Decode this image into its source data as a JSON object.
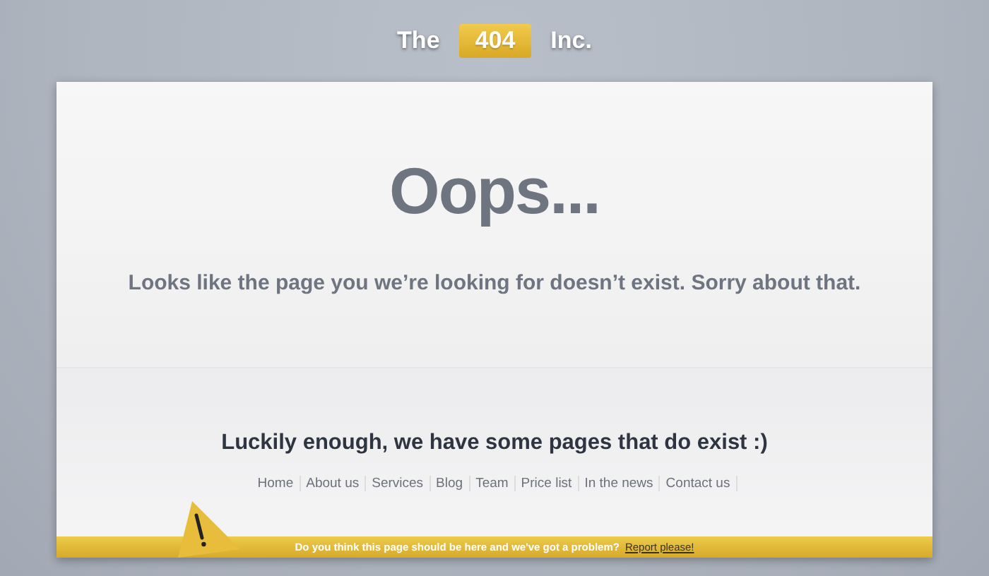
{
  "brand": {
    "before": "The",
    "badge": "404",
    "after": "Inc."
  },
  "headline": "Oops...",
  "message": "Looks like the page you we’re looking for doesn’t exist. Sorry about that.",
  "subheading": "Luckily enough, we have some pages that do exist :)",
  "links": [
    "Home",
    "About us",
    "Services",
    "Blog",
    "Team",
    "Price list",
    "In the news",
    "Contact us"
  ],
  "footer": {
    "text": "Do you think this page should be here and we've got a problem?",
    "link": "Report please!"
  }
}
